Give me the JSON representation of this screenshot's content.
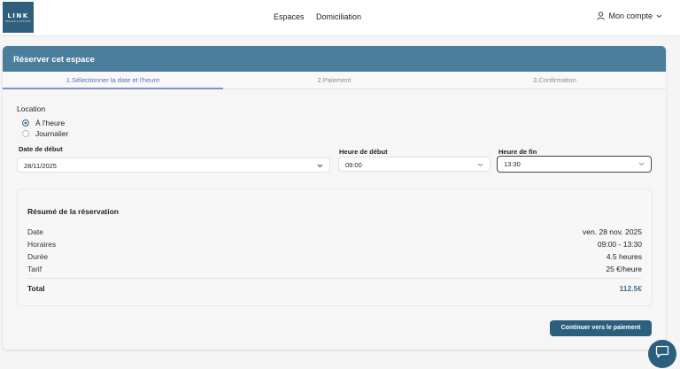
{
  "brand": {
    "logo_text": "LINK",
    "logo_sub": "SPACES & OFFICES"
  },
  "nav": {
    "espaces": "Espaces",
    "domiciliation": "Domiciliation"
  },
  "account": {
    "label": "Mon compte"
  },
  "booking": {
    "title": "Réserver cet espace",
    "steps": [
      "1.Sélectionner la date et l'heure",
      "2.Paiement",
      "3.Confirmation"
    ],
    "active_step": 1,
    "location_label": "Location",
    "options": [
      {
        "label": "À l'heure",
        "checked": true
      },
      {
        "label": "Journalier",
        "checked": false
      }
    ],
    "start_date_label": "Date de début",
    "start_date_value": "28/11/2025",
    "start_time_label": "Heure de début",
    "start_time_value": "09:00",
    "end_time_label": "Heure de fin",
    "end_time_value": "13:30"
  },
  "summary": {
    "title": "Résumé de la réservation",
    "rows": [
      {
        "label": "Date",
        "value": "ven. 28 nov. 2025"
      },
      {
        "label": "Horaires",
        "value": "09:00 - 13:30"
      },
      {
        "label": "Durée",
        "value": "4.5 heures"
      },
      {
        "label": "Tarif",
        "value": "25 €/heure"
      }
    ],
    "total_label": "Total",
    "total_value": "112.5€"
  },
  "actions": {
    "continue_label": "Continuer vers le paiement"
  },
  "colors": {
    "primary": "#2b5f7e",
    "header_band": "#4b7d9c",
    "active_step": "#5872b8"
  },
  "icons": {
    "account": "user-icon",
    "dropdown": "chevron-down-icon",
    "chat": "chat-icon"
  }
}
